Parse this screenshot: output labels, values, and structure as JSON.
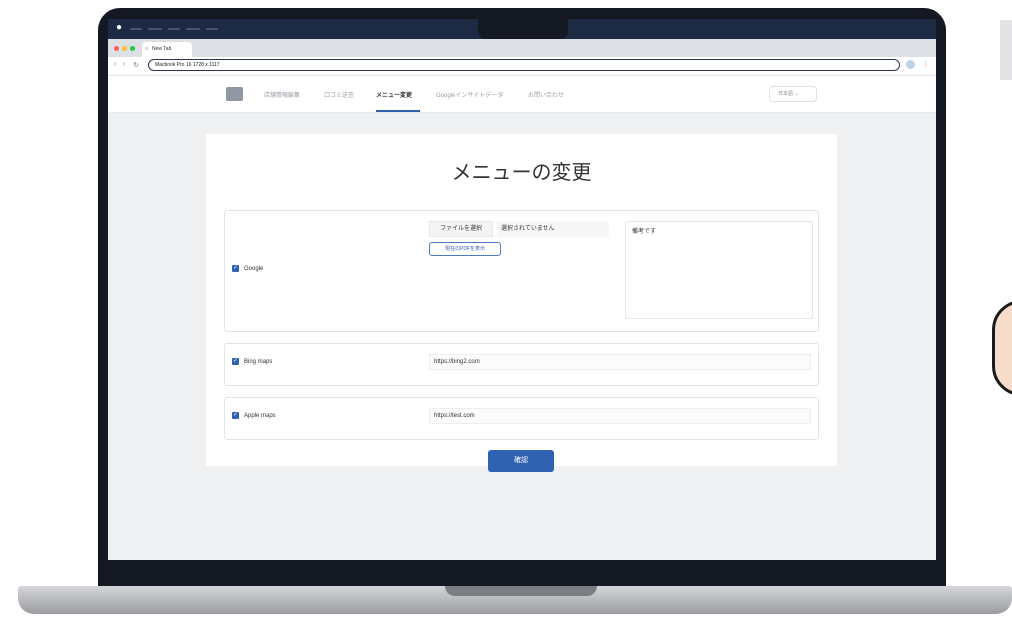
{
  "browser": {
    "tab_title": "New Tab",
    "url": "Macbook Pro 16 1728 x 1117"
  },
  "site_nav": {
    "items": [
      {
        "label": "店舗情報編集"
      },
      {
        "label": "口コミ送信"
      },
      {
        "label": "メニュー変更"
      },
      {
        "label": "Googleインサイトデータ"
      },
      {
        "label": "お問い合わせ"
      }
    ],
    "active_index": 2,
    "language": "日本語"
  },
  "form": {
    "title": "メニューの変更",
    "rows": [
      {
        "label": "Google",
        "checked": true,
        "file_button": "ファイルを選択",
        "file_status": "選択されていません",
        "pdf_link": "現在のPDFを表示",
        "memo": "備考です"
      },
      {
        "label": "Bing maps",
        "checked": true,
        "url_value": "https://bing2.com"
      },
      {
        "label": "Apple maps",
        "checked": true,
        "url_value": "https://test.com"
      }
    ],
    "confirm_label": "確認"
  },
  "colors": {
    "accent": "#2f62b0",
    "menubar": "#1d2a44",
    "page_bg": "#eef0f2"
  }
}
